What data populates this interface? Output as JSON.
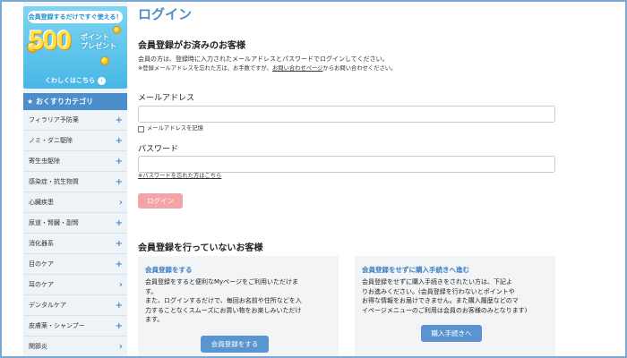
{
  "banner": {
    "pill": "会員登録するだけですぐ使える！",
    "amount": "500",
    "sub_line1": "ポイント",
    "sub_line2": "プレゼント",
    "link": "くわしくはこちら",
    "link_arrow": "›"
  },
  "sidebar": {
    "heading_icon": "★",
    "heading": "おくすりカテゴリ",
    "items": [
      {
        "label": "フィラリア予防薬",
        "indicator": "+"
      },
      {
        "label": "ノミ・ダニ駆除",
        "indicator": "+"
      },
      {
        "label": "寄生虫駆除",
        "indicator": "+"
      },
      {
        "label": "感染症・抗生物質",
        "indicator": "+"
      },
      {
        "label": "心臓疾患",
        "indicator": "›"
      },
      {
        "label": "尿道・腎臓・副腎",
        "indicator": "+"
      },
      {
        "label": "消化器系",
        "indicator": "+"
      },
      {
        "label": "目のケア",
        "indicator": "+"
      },
      {
        "label": "耳のケア",
        "indicator": "›"
      },
      {
        "label": "デンタルケア",
        "indicator": "+"
      },
      {
        "label": "皮膚薬・シャンプー",
        "indicator": "+"
      },
      {
        "label": "関節炎",
        "indicator": "›"
      }
    ]
  },
  "main": {
    "title": "ログイン",
    "member_section": {
      "title": "会員登録がお済みのお客様",
      "desc": "会員の方は、登録時に入力されたメールアドレスとパスワードでログインしてください。",
      "note_prefix": "※登録メールアドレスを忘れた方は、お手数ですが、",
      "note_link": "お問い合わせページ",
      "note_suffix": "からお問い合わせください。",
      "email_label": "メールアドレス",
      "email_value": "",
      "remember_label": "メールアドレスを記憶",
      "password_label": "パスワード",
      "password_value": "",
      "forgot_link": "※パスワードを忘れた方はこちら",
      "login_button": "ログイン"
    },
    "nonmember_section": {
      "title": "会員登録を行っていないお客様",
      "register_box": {
        "title": "会員登録をする",
        "lines": [
          "会員登録をすると便利なMyページをご利用いただけま",
          "す。",
          "また、ログインするだけで、毎回お名前や住所などを入",
          "力することなくスムーズにお買い物をお楽しみいただけ",
          "ます。"
        ],
        "button": "会員登録をする"
      },
      "guest_box": {
        "title": "会員登録をせずに購入手続きへ進む",
        "lines": [
          "会員登録をせずに購入手続きをされたい方は、下記よ",
          "りお進みください。(会員登録を行わないとポイントや",
          "お得な情報をお届けできません。また購入履歴などのマ",
          "イページメニューのご利用は会員のお客様のみとなります)"
        ],
        "button": "購入手続きへ"
      }
    }
  }
}
